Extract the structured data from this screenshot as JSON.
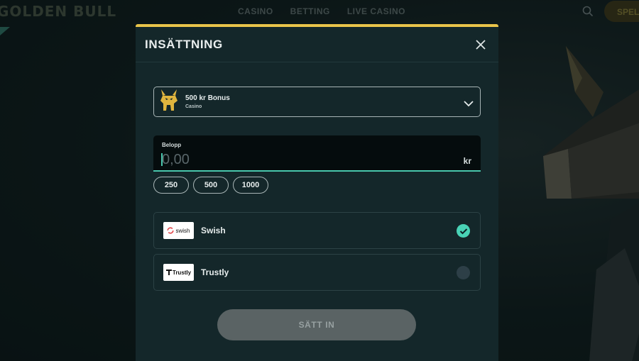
{
  "background": {
    "logo": "GOLDEN BULL",
    "nav": [
      "CASINO",
      "BETTING",
      "LIVE CASINO"
    ],
    "play_button": "SPEL"
  },
  "modal": {
    "title": "INSÄTTNING",
    "accent_color": "#e9c44a",
    "bonus": {
      "title": "500 kr Bonus",
      "subtitle": "Casino"
    },
    "amount": {
      "label": "Belopp",
      "placeholder": "0,00",
      "value": "",
      "currency": "kr"
    },
    "quick_amounts": [
      "250",
      "500",
      "1000"
    ],
    "payment_methods": [
      {
        "name": "Swish",
        "logo_text": "swish",
        "selected": true
      },
      {
        "name": "Trustly",
        "logo_text": "Trustly",
        "selected": false
      }
    ],
    "submit_label": "SÄTT IN"
  },
  "colors": {
    "selected_check": "#49d3b6",
    "input_underline": "#49c7ad",
    "modal_bg": "#14272a"
  }
}
